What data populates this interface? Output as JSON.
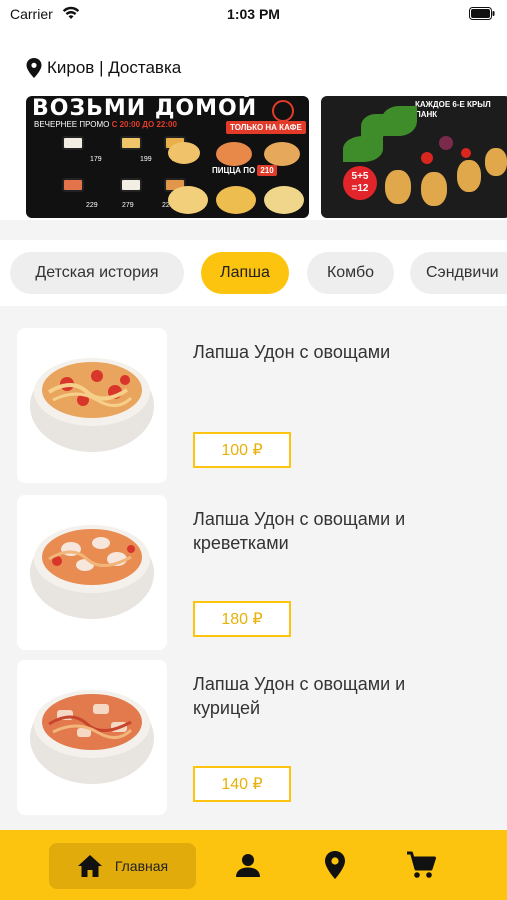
{
  "status_bar": {
    "carrier": "Carrier",
    "time": "1:03 PM"
  },
  "location": {
    "text": "Киров | Доставка"
  },
  "banners": [
    {
      "title": "ВОЗЬМИ ДОМОЙ",
      "subtitle_prefix": "ВЕЧЕРНЕЕ ПРОМО",
      "subtitle_time": "С 20:00 ДО 22:00",
      "badge": "ТОЛЬКО НА КАФЕ",
      "pizza_price_label": "ПИЦЦА ПО",
      "pizza_price": "210",
      "roll_prices": [
        "179",
        "199",
        "229",
        "229",
        "279",
        "229"
      ]
    },
    {
      "title_line1": "КАЖДОЕ 6-Е КРЫЛ",
      "title_line2": "ПАНК",
      "badge": "5+5 =12"
    }
  ],
  "categories": [
    {
      "label": "Детская история",
      "active": false
    },
    {
      "label": "Лапша",
      "active": true
    },
    {
      "label": "Комбо",
      "active": false
    },
    {
      "label": "Сэндвичи",
      "active": false
    }
  ],
  "products": [
    {
      "title": "Лапша Удон с овощами",
      "price": "100 ₽"
    },
    {
      "title": "Лапша Удон с овощами и креветками",
      "price": "180 ₽"
    },
    {
      "title": "Лапша Удон с овощами и курицей",
      "price": "140 ₽"
    }
  ],
  "bottom_nav": {
    "home_label": "Главная",
    "icons": [
      "home-icon",
      "profile-icon",
      "location-icon",
      "cart-icon"
    ]
  },
  "colors": {
    "accent": "#fcc40e",
    "accent_dark": "#e0ab0b",
    "price_text": "#e7b10a",
    "background": "#f4f4f4"
  }
}
